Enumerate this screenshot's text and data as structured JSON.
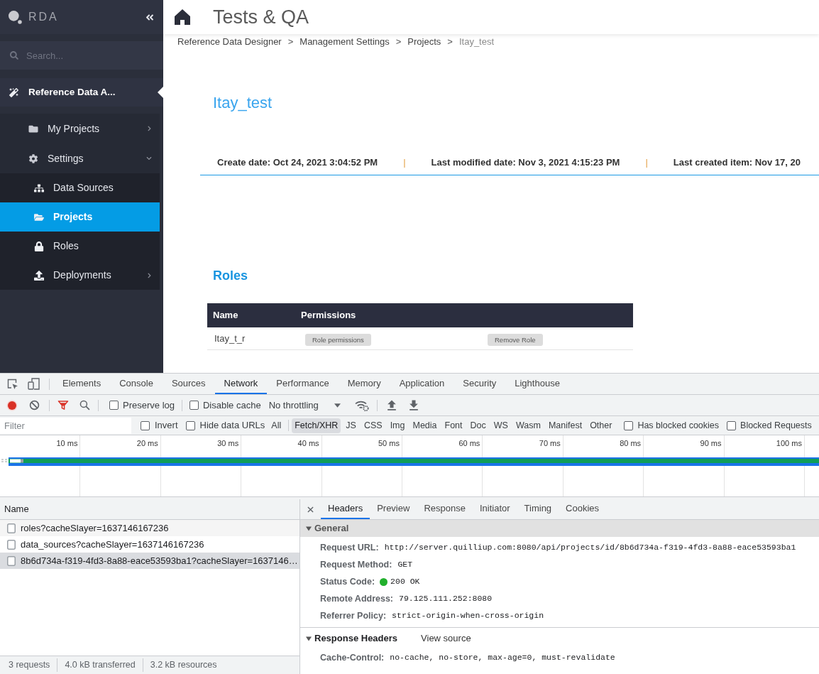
{
  "sidebar": {
    "logo": "RDA",
    "search": {
      "placeholder": "Search..."
    },
    "nav": [
      {
        "label": "Reference Data A...",
        "selected": true,
        "children": [
          {
            "label": "My Projects",
            "kind": "group",
            "expanded": false,
            "selected": false
          },
          {
            "label": "Settings",
            "kind": "group",
            "expanded": true,
            "selected": false,
            "children": [
              {
                "label": "Data Sources",
                "kind": "link",
                "selected": false
              },
              {
                "label": "Projects",
                "kind": "link",
                "selected": true
              },
              {
                "label": "Roles",
                "kind": "link",
                "selected": false
              },
              {
                "label": "Deployments",
                "kind": "group",
                "expanded": false,
                "selected": false
              }
            ]
          }
        ]
      }
    ]
  },
  "header": {
    "title": "Tests & QA"
  },
  "breadcrumb": [
    {
      "kind": "link",
      "label": "Reference Data Designer"
    },
    {
      "kind": "separator",
      "label": ">"
    },
    {
      "kind": "link",
      "label": "Management Settings"
    },
    {
      "kind": "separator",
      "label": ">"
    },
    {
      "kind": "link",
      "label": "Projects"
    },
    {
      "kind": "separator",
      "label": ">"
    },
    {
      "kind": "current",
      "label": "Itay_test"
    }
  ],
  "project": {
    "title": "Itay_test",
    "meta": [
      {
        "kind": "field",
        "text": "Create date: Oct 24, 2021 3:04:52 PM"
      },
      {
        "kind": "separator",
        "text": "|"
      },
      {
        "kind": "field",
        "text": "Last modified date: Nov 3, 2021 4:15:23 PM"
      },
      {
        "kind": "separator",
        "text": "|"
      },
      {
        "kind": "field",
        "text": "Last created item: Nov 17, 20"
      }
    ]
  },
  "roles": {
    "title": "Roles",
    "columns": [
      "Name",
      "Permissions"
    ],
    "rows": [
      {
        "name": "Itay_t_r",
        "actions": [
          "Role permissions",
          "Remove Role"
        ]
      }
    ]
  },
  "devtools": {
    "tabs": [
      {
        "label": "Elements",
        "selected": false
      },
      {
        "label": "Console",
        "selected": false
      },
      {
        "label": "Sources",
        "selected": false
      },
      {
        "label": "Network",
        "selected": true
      },
      {
        "label": "Performance",
        "selected": false
      },
      {
        "label": "Memory",
        "selected": false
      },
      {
        "label": "Application",
        "selected": false
      },
      {
        "label": "Security",
        "selected": false
      },
      {
        "label": "Lighthouse",
        "selected": false
      }
    ],
    "toolbar": {
      "recording": true,
      "preserve_log": {
        "label": "Preserve log",
        "checked": false
      },
      "disable_cache": {
        "label": "Disable cache",
        "checked": false
      },
      "throttling": "No throttling"
    },
    "filter_bar": {
      "placeholder": "Filter",
      "options": [
        {
          "label": "Invert",
          "checked": false
        },
        {
          "label": "Hide data URLs",
          "checked": false
        }
      ],
      "types": [
        {
          "label": "All",
          "selected": false
        },
        {
          "label": "Fetch/XHR",
          "selected": true
        },
        {
          "label": "JS",
          "selected": false
        },
        {
          "label": "CSS",
          "selected": false
        },
        {
          "label": "Img",
          "selected": false
        },
        {
          "label": "Media",
          "selected": false
        },
        {
          "label": "Font",
          "selected": false
        },
        {
          "label": "Doc",
          "selected": false
        },
        {
          "label": "WS",
          "selected": false
        },
        {
          "label": "Wasm",
          "selected": false
        },
        {
          "label": "Manifest",
          "selected": false
        },
        {
          "label": "Other",
          "selected": false
        }
      ],
      "extra_options": [
        {
          "label": "Has blocked cookies",
          "checked": false
        },
        {
          "label": "Blocked Requests",
          "checked": false
        }
      ]
    },
    "overview": {
      "ticks": [
        "10 ms",
        "20 ms",
        "30 ms",
        "40 ms",
        "50 ms",
        "60 ms",
        "70 ms",
        "80 ms",
        "90 ms",
        "100 ms"
      ]
    },
    "requests": {
      "column": "Name",
      "rows": [
        {
          "name": "roles?cacheSlayer=1637146167236",
          "selected": false
        },
        {
          "name": "data_sources?cacheSlayer=1637146167236",
          "selected": false
        },
        {
          "name": "8b6d734a-f319-4fd3-8a88-eace53593ba1?cacheSlayer=1637146…",
          "selected": true
        }
      ]
    },
    "summary": [
      "3 requests",
      "4.0 kB transferred",
      "3.2 kB resources"
    ],
    "details": {
      "tabs": [
        {
          "label": "Headers",
          "selected": true
        },
        {
          "label": "Preview",
          "selected": false
        },
        {
          "label": "Response",
          "selected": false
        },
        {
          "label": "Initiator",
          "selected": false
        },
        {
          "label": "Timing",
          "selected": false
        },
        {
          "label": "Cookies",
          "selected": false
        }
      ],
      "sections": [
        {
          "title": "General",
          "expanded": true,
          "rows": [
            {
              "label": "Request URL:",
              "value": "http://server.quilliup.com:8080/api/projects/id/8b6d734a-f319-4fd3-8a88-eace53593ba1"
            },
            {
              "label": "Request Method:",
              "value": "GET"
            },
            {
              "label": "Status Code:",
              "value": "200 OK",
              "color": "#22b02d"
            },
            {
              "label": "Remote Address:",
              "value": "79.125.111.252:8080"
            },
            {
              "label": "Referrer Policy:",
              "value": "strict-origin-when-cross-origin"
            }
          ]
        },
        {
          "title": "Response Headers",
          "expanded": true,
          "action": "View source",
          "rows": [
            {
              "label": "Cache-Control:",
              "value": "no-cache, no-store, max-age=0, must-revalidate"
            }
          ]
        }
      ]
    }
  }
}
